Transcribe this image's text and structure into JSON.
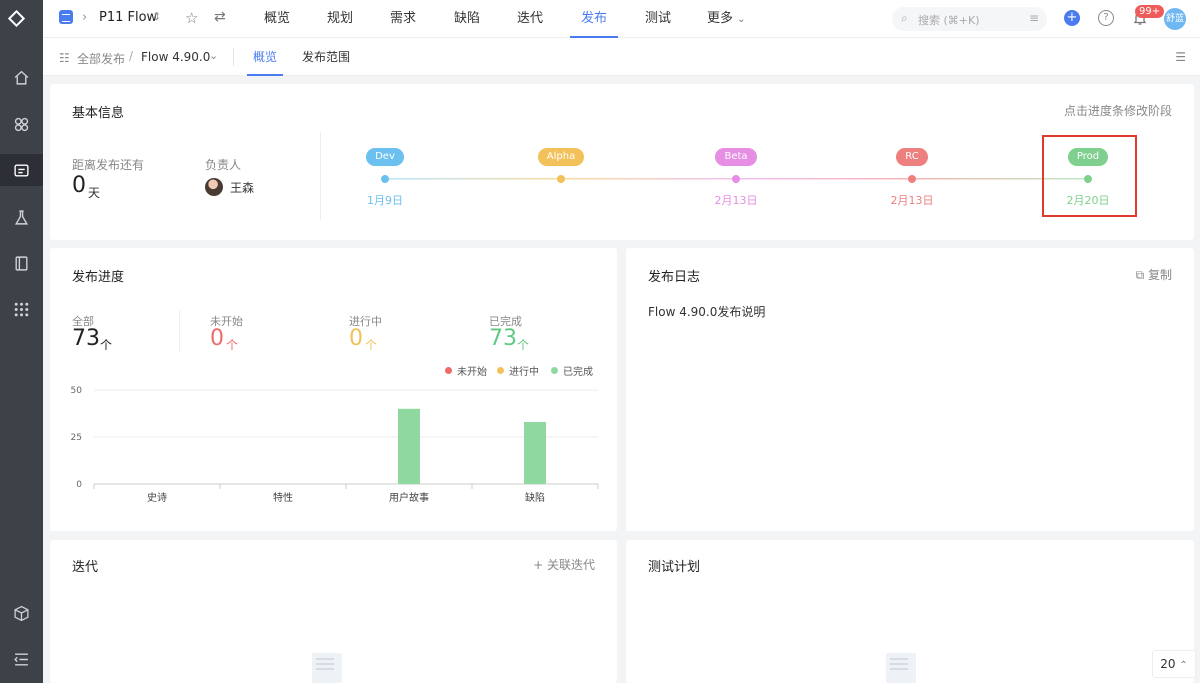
{
  "topbar": {
    "project_name": "P11 Flow",
    "nav_tabs": [
      "概览",
      "规划",
      "需求",
      "缺陷",
      "迭代",
      "发布",
      "测试",
      "更多"
    ],
    "active_tab": "发布",
    "search_placeholder": "搜索 (⌘+K)",
    "notification_badge": "99+",
    "user_avatar_text": "舒蓝"
  },
  "subbar": {
    "breadcrumb_root": "全部发布",
    "version": "Flow 4.90.0",
    "tabs": [
      "概览",
      "发布范围"
    ],
    "active_tab": "概览"
  },
  "basic_info": {
    "title": "基本信息",
    "hint": "点击进度条修改阶段",
    "countdown_label": "距离发布还有",
    "countdown_value": "0",
    "countdown_unit": "天",
    "owner_label": "负责人",
    "owner_name": "王森",
    "stages": [
      {
        "name": "Dev",
        "date": "1月9日",
        "color": "#6cc0f0"
      },
      {
        "name": "Alpha",
        "date": "",
        "color": "#f2c15a"
      },
      {
        "name": "Beta",
        "date": "2月13日",
        "color": "#e58ee3"
      },
      {
        "name": "RC",
        "date": "2月13日",
        "color": "#ee7f7f"
      },
      {
        "name": "Prod",
        "date": "2月20日",
        "color": "#7fd08e"
      }
    ]
  },
  "progress": {
    "title": "发布进度",
    "stats": [
      {
        "label": "全部",
        "value": "73",
        "unit": "个",
        "color": "#222"
      },
      {
        "label": "未开始",
        "value": "0",
        "unit": "个",
        "color": "#ef6a6a"
      },
      {
        "label": "进行中",
        "value": "0",
        "unit": "个",
        "color": "#f2c15a"
      },
      {
        "label": "已完成",
        "value": "73",
        "unit": "个",
        "color": "#62c982"
      }
    ],
    "legend": [
      {
        "label": "未开始",
        "color": "#ef6a6a"
      },
      {
        "label": "进行中",
        "color": "#f2c15a"
      },
      {
        "label": "已完成",
        "color": "#8fd89f"
      }
    ]
  },
  "chart_data": {
    "type": "bar",
    "categories": [
      "史诗",
      "特性",
      "用户故事",
      "缺陷"
    ],
    "series": [
      {
        "name": "未开始",
        "values": [
          0,
          0,
          0,
          0
        ],
        "color": "#ef6a6a"
      },
      {
        "name": "进行中",
        "values": [
          0,
          0,
          0,
          0
        ],
        "color": "#f2c15a"
      },
      {
        "name": "已完成",
        "values": [
          0,
          0,
          40,
          33
        ],
        "color": "#8fd89f"
      }
    ],
    "yticks": [
      0,
      25,
      50
    ],
    "ylim": [
      0,
      50
    ],
    "grid": true,
    "legend_position": "top-right"
  },
  "release_log": {
    "title": "发布日志",
    "copy_label": "复制",
    "content": "Flow 4.90.0发布说明"
  },
  "iterations": {
    "title": "迭代",
    "action_label": "关联迭代"
  },
  "test_plan": {
    "title": "测试计划"
  },
  "pager": {
    "count": "20"
  }
}
